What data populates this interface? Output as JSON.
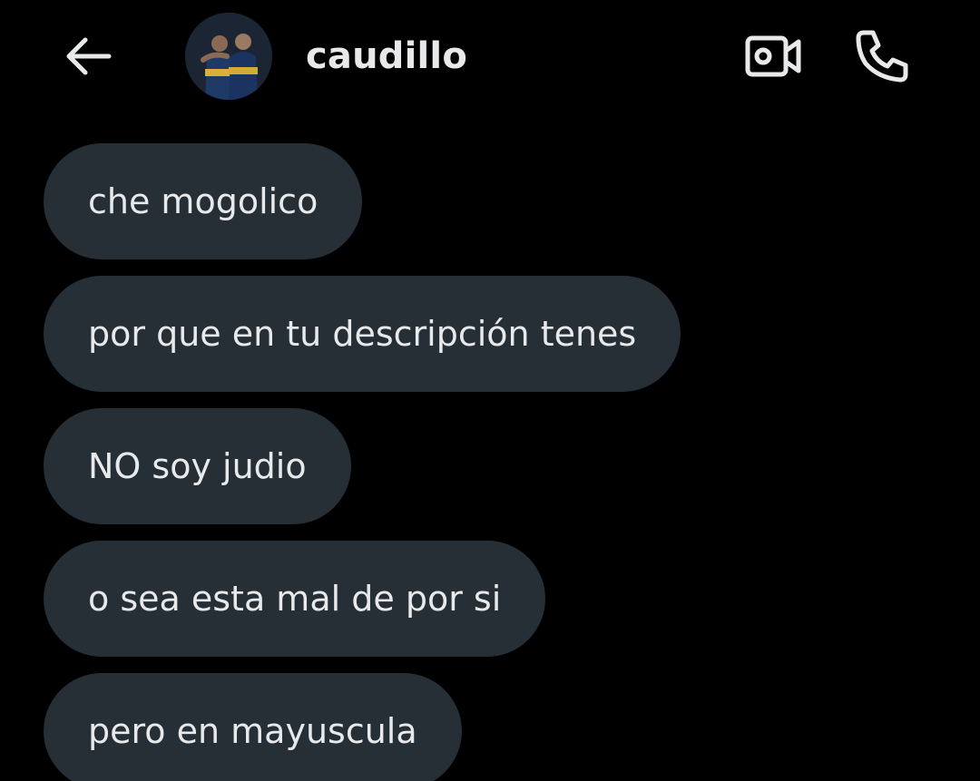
{
  "header": {
    "back_icon": "arrow-left-icon",
    "username": "caudillo",
    "video_icon": "video-camera-icon",
    "call_icon": "phone-icon"
  },
  "messages": [
    {
      "text": "che mogolico"
    },
    {
      "text": "por que en tu descripción tenes"
    },
    {
      "text": "NO soy judio"
    },
    {
      "text": "o sea esta mal de por si"
    },
    {
      "text": "pero en mayuscula"
    }
  ],
  "colors": {
    "background": "#000000",
    "bubble": "#262e36",
    "text": "#e7e9ea"
  }
}
